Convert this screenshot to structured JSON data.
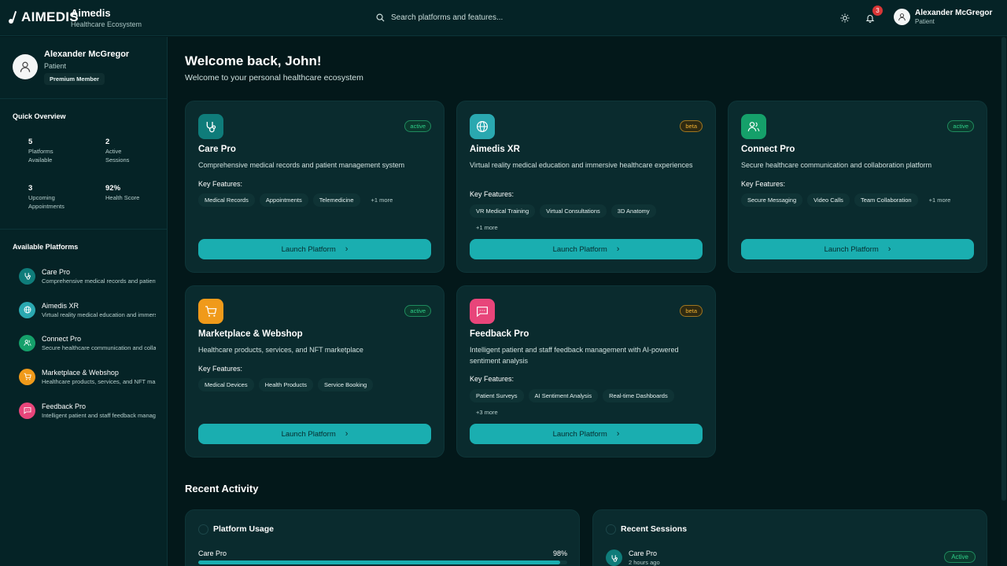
{
  "topbar": {
    "logo_text": "AIMEDIS",
    "brand_name": "Aimedis",
    "brand_sub": "Healthcare Ecosystem",
    "search_placeholder": "Search platforms and features...",
    "notification_count": "3",
    "user_name": "Alexander McGregor",
    "user_role": "Patient"
  },
  "sidebar": {
    "profile": {
      "name": "Alexander McGregor",
      "role": "Patient",
      "badge": "Premium Member"
    },
    "overview_title": "Quick Overview",
    "stats": [
      {
        "value": "5",
        "label": "Platforms Available"
      },
      {
        "value": "2",
        "label": "Active Sessions"
      },
      {
        "value": "3",
        "label": "Upcoming Appointments"
      },
      {
        "value": "92%",
        "label": "Health Score"
      }
    ],
    "platforms_title": "Available Platforms",
    "platforms": [
      {
        "name": "Care Pro",
        "desc": "Comprehensive medical records and patient management system",
        "icon": "stethoscope-icon",
        "color": "#0f7c7a"
      },
      {
        "name": "Aimedis XR",
        "desc": "Virtual reality medical education and immersive healthcare experiences",
        "icon": "globe-icon",
        "color": "#2aa8b0"
      },
      {
        "name": "Connect Pro",
        "desc": "Secure healthcare communication and collaboration platform",
        "icon": "users-icon",
        "color": "#15a06a"
      },
      {
        "name": "Marketplace & Webshop",
        "desc": "Healthcare products, services, and NFT marketplace",
        "icon": "cart-icon",
        "color": "#f09a1a"
      },
      {
        "name": "Feedback Pro",
        "desc": "Intelligent patient and staff feedback management with AI-powered sentiment analysis",
        "icon": "message-icon",
        "color": "#e8457a"
      }
    ]
  },
  "main": {
    "welcome_title": "Welcome back, John!",
    "welcome_sub": "Welcome to your personal healthcare ecosystem",
    "key_features_label": "Key Features:",
    "launch_label": "Launch Platform",
    "cards": [
      {
        "title": "Care Pro",
        "status": "active",
        "desc": "Comprehensive medical records and patient management system",
        "tags": [
          "Medical Records",
          "Appointments",
          "Telemedicine"
        ],
        "more": "+1 more",
        "icon": "stethoscope-icon",
        "color": "#0f7c7a"
      },
      {
        "title": "Aimedis XR",
        "status": "beta",
        "desc": "Virtual reality medical education and immersive healthcare experiences",
        "tags": [
          "VR Medical Training",
          "Virtual Consultations",
          "3D Anatomy"
        ],
        "more": "+1 more",
        "icon": "globe-icon",
        "color": "#2aa8b0"
      },
      {
        "title": "Connect Pro",
        "status": "active",
        "desc": "Secure healthcare communication and collaboration platform",
        "tags": [
          "Secure Messaging",
          "Video Calls",
          "Team Collaboration"
        ],
        "more": "+1 more",
        "icon": "users-icon",
        "color": "#15a06a"
      },
      {
        "title": "Marketplace & Webshop",
        "status": "active",
        "desc": "Healthcare products, services, and NFT marketplace",
        "tags": [
          "Medical Devices",
          "Health Products",
          "Service Booking"
        ],
        "more": "",
        "icon": "cart-icon",
        "color": "#f09a1a"
      },
      {
        "title": "Feedback Pro",
        "status": "beta",
        "desc": "Intelligent patient and staff feedback management with AI-powered sentiment analysis",
        "tags": [
          "Patient Surveys",
          "AI Sentiment Analysis",
          "Real-time Dashboards"
        ],
        "more": "+3 more",
        "icon": "message-icon",
        "color": "#e8457a"
      }
    ],
    "recent_title": "Recent Activity",
    "usage": {
      "title": "Platform Usage",
      "rows": [
        {
          "name": "Care Pro",
          "pct": "98%",
          "fraction": 0.98
        }
      ]
    },
    "sessions": {
      "title": "Recent Sessions",
      "rows": [
        {
          "name": "Care Pro",
          "time": "2 hours ago",
          "status": "Active"
        }
      ]
    }
  }
}
